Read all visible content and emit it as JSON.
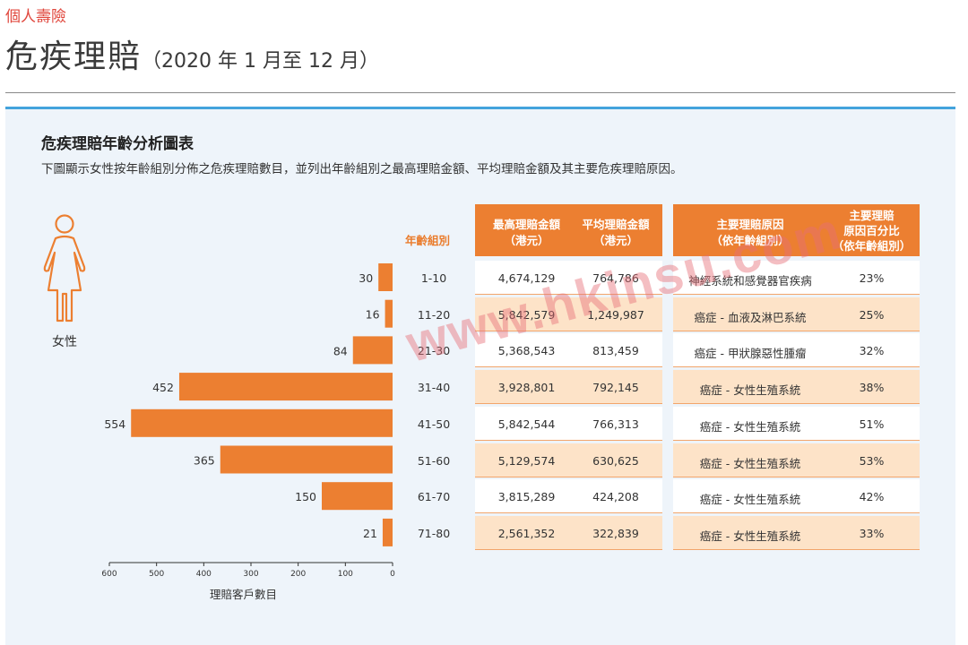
{
  "header": {
    "section_label": "個人壽險",
    "title_main": "危疾理賠",
    "title_period": "（2020 年 1 月至 12 月）"
  },
  "chart_data": {
    "type": "bar",
    "orientation": "horizontal",
    "title": "危疾理賠年齡分析圖表",
    "subtitle": "下圖顯示女性按年齡組別分佈之危疾理賠數目，並列出年齡組別之最高理賠金額、平均理賠金額及其主要危疾理賠原因。",
    "figure_label": "女性",
    "category_header": "年齡組別",
    "categories": [
      "1-10",
      "11-20",
      "21-30",
      "31-40",
      "41-50",
      "51-60",
      "61-70",
      "71-80"
    ],
    "values": [
      30,
      16,
      84,
      452,
      554,
      365,
      150,
      21
    ],
    "xlabel": "理賠客戶數目",
    "xlim": [
      0,
      600
    ],
    "x_ticks": [
      "600",
      "500",
      "400",
      "300",
      "200",
      "100",
      "0"
    ],
    "bar_color": "#ec7f31",
    "table": {
      "headers": {
        "max_claim": [
          "最高理賠金額",
          "（港元）"
        ],
        "avg_claim": [
          "平均理賠金額",
          "（港元）"
        ],
        "main_cause": [
          "主要理賠原因",
          "（依年齡組別）"
        ],
        "cause_pct": [
          "主要理賠",
          "原因百分比",
          "（依年齡組別）"
        ]
      },
      "max_claim": [
        "4,674,129",
        "5,842,579",
        "5,368,543",
        "3,928,801",
        "5,842,544",
        "5,129,574",
        "3,815,289",
        "2,561,352"
      ],
      "avg_claim": [
        "764,786",
        "1,249,987",
        "813,459",
        "792,145",
        "766,313",
        "630,625",
        "424,208",
        "322,839"
      ],
      "main_cause": [
        "神經系統和感覺器官疾病",
        "癌症 - 血液及淋巴系統",
        "癌症 - 甲狀腺惡性腫瘤",
        "癌症 - 女性生殖系統",
        "癌症 - 女性生殖系統",
        "癌症 - 女性生殖系統",
        "癌症 - 女性生殖系統",
        "癌症 - 女性生殖系統"
      ],
      "cause_pct": [
        "23%",
        "25%",
        "32%",
        "38%",
        "51%",
        "53%",
        "42%",
        "33%"
      ]
    }
  },
  "watermark": "www.hkinsu.com",
  "colors": {
    "accent": "#ec7f31",
    "row_highlight": "#fde3c8",
    "panel_bg": "#eef4fa",
    "panel_rule": "#43a3dc",
    "section_label": "#e0473d"
  }
}
